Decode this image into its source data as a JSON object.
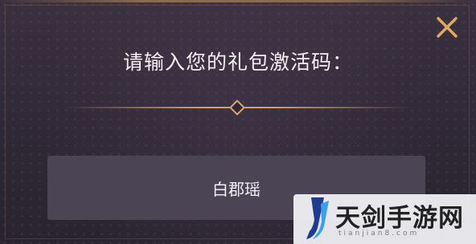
{
  "dialog": {
    "title": "请输入您的礼包激活码：",
    "input_value": "白郡瑶",
    "close_icon": "close-icon"
  },
  "watermark": {
    "brand_text": "天剑手游网",
    "domain_text": "tianjian8.com"
  },
  "colors": {
    "accent_gold": "#e2a862",
    "background": "#2f2836",
    "input_bg": "#4a4455",
    "text": "#f4eef3"
  }
}
